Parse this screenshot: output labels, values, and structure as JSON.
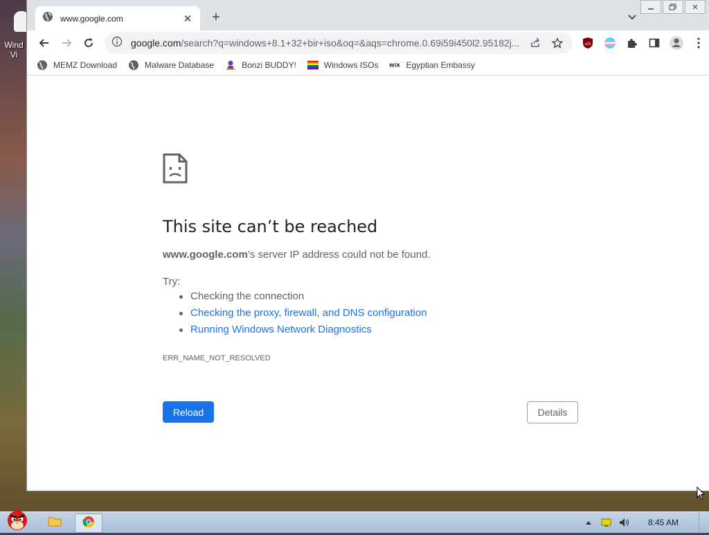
{
  "desktop": {
    "icon_label": "Wind\nVi"
  },
  "browser": {
    "tab": {
      "title": "www.google.com"
    },
    "omnibox": {
      "host": "google.com",
      "path": "/search?q=windows+8.1+32+bir+iso&oq=&aqs=chrome.0.69i59i450l2.95182j..."
    },
    "bookmarks": [
      {
        "label": "MEMZ Download",
        "icon": "globe-icon"
      },
      {
        "label": "Malware Database",
        "icon": "globe-icon"
      },
      {
        "label": "Bonzi BUDDY!",
        "icon": "bonzi-icon"
      },
      {
        "label": "Windows ISOs",
        "icon": "rainbow-flag-icon"
      },
      {
        "label": "Egyptian Embassy",
        "icon": "wix-icon"
      }
    ]
  },
  "error_page": {
    "title": "This site can’t be reached",
    "host": "www.google.com",
    "desc_rest": "’s server IP address could not be found.",
    "try_label": "Try:",
    "suggestions": [
      "Checking the connection",
      "Checking the proxy, firewall, and DNS configuration",
      "Running Windows Network Diagnostics"
    ],
    "error_code": "ERR_NAME_NOT_RESOLVED",
    "reload_label": "Reload",
    "details_label": "Details"
  },
  "taskbar": {
    "clock": "8:45 AM"
  },
  "colors": {
    "accent": "#1a73e8",
    "link": "#1a73e8",
    "text": "#202124",
    "muted": "#5f6368"
  }
}
